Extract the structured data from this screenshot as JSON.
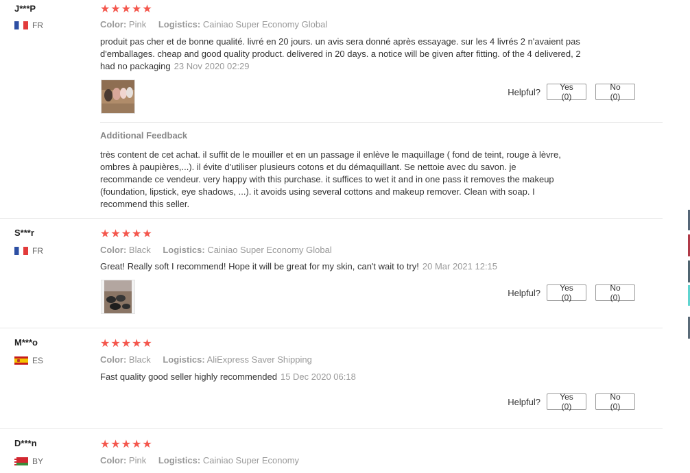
{
  "reviews": [
    {
      "user": "J***P",
      "country": "FR",
      "flag": "fr",
      "rating": "★★★★★",
      "color_label": "Color:",
      "color_value": "Pink",
      "logistics_label": "Logistics:",
      "logistics_value": "Cainiao Super Economy Global",
      "text": "produit pas cher et de bonne qualité. livré en 20 jours. un avis sera donné après essayage. sur les 4 livrés 2 n'avaient pas d'emballages. cheap and good quality product. delivered in 20 days. a notice will be given after fitting. of the 4 delivered, 2 had no packaging",
      "date": "23 Nov 2020 02:29",
      "helpful_label": "Helpful?",
      "yes_label": "Yes (0)",
      "no_label": "No (0)",
      "additional_title": "Additional Feedback",
      "additional_text": "très content de cet achat. il suffit de le mouiller et en un passage il enlève le maquillage ( fond de teint, rouge à lèvre, ombres à paupières,...). il évite d'utiliser plusieurs cotons et du démaquillant. Se nettoie avec du savon. je recommande ce vendeur. very happy with this purchase. it suffices to wet it and in one pass it removes the makeup (foundation, lipstick, eye shadows, ...). it avoids using several cottons and makeup remover. Clean with soap. I recommend this seller."
    },
    {
      "user": "S***r",
      "country": "FR",
      "flag": "fr",
      "rating": "★★★★★",
      "color_label": "Color:",
      "color_value": "Black",
      "logistics_label": "Logistics:",
      "logistics_value": "Cainiao Super Economy Global",
      "text": "Great! Really soft I recommend! Hope it will be great for my skin, can't wait to try!",
      "date": "20 Mar 2021 12:15",
      "helpful_label": "Helpful?",
      "yes_label": "Yes (0)",
      "no_label": "No (0)"
    },
    {
      "user": "M***o",
      "country": "ES",
      "flag": "es",
      "rating": "★★★★★",
      "color_label": "Color:",
      "color_value": "Black",
      "logistics_label": "Logistics:",
      "logistics_value": "AliExpress Saver Shipping",
      "text": "Fast quality good seller highly recommended",
      "date": "15 Dec 2020 06:18",
      "helpful_label": "Helpful?",
      "yes_label": "Yes (0)",
      "no_label": "No (0)"
    },
    {
      "user": "D***n",
      "country": "BY",
      "flag": "by",
      "rating": "★★★★★",
      "color_label": "Color:",
      "color_value": "Pink",
      "logistics_label": "Logistics:",
      "logistics_value": "Cainiao Super Economy"
    }
  ],
  "colors": {
    "star": "#f4574d",
    "muted": "#999999",
    "border": "#e8e8e8"
  }
}
